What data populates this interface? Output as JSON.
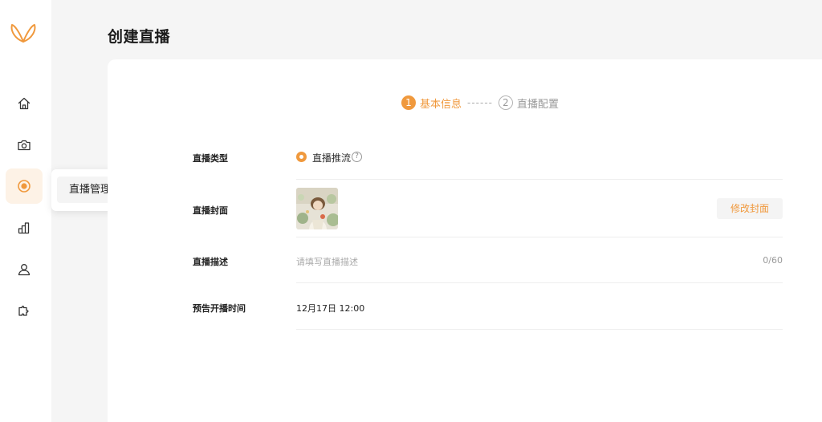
{
  "sidebar": {
    "items": [
      {
        "name": "home",
        "icon": "home-icon"
      },
      {
        "name": "camera",
        "icon": "camera-icon"
      },
      {
        "name": "live",
        "icon": "live-record-icon",
        "active": true
      },
      {
        "name": "stats",
        "icon": "bar-chart-icon"
      },
      {
        "name": "user",
        "icon": "user-icon"
      },
      {
        "name": "plugin",
        "icon": "puzzle-icon"
      }
    ],
    "flyout": {
      "label": "直播管理"
    }
  },
  "page": {
    "title": "创建直播"
  },
  "steps": [
    {
      "num": "1",
      "label": "基本信息",
      "active": true
    },
    {
      "num": "2",
      "label": "直播配置",
      "active": false
    }
  ],
  "steps_separator": "------",
  "form": {
    "type": {
      "label": "直播类型",
      "option": "直播推流",
      "help": "?"
    },
    "cover": {
      "label": "直播封面",
      "button": "修改封面"
    },
    "description": {
      "label": "直播描述",
      "placeholder": "请填写直播描述",
      "value": "",
      "counter": "0/60"
    },
    "time": {
      "label": "预告开播时间",
      "value": "12月17日 12:00"
    }
  },
  "colors": {
    "accent": "#f0993d",
    "accent_bg": "#fdf2e6",
    "background": "#f5f5f5"
  }
}
